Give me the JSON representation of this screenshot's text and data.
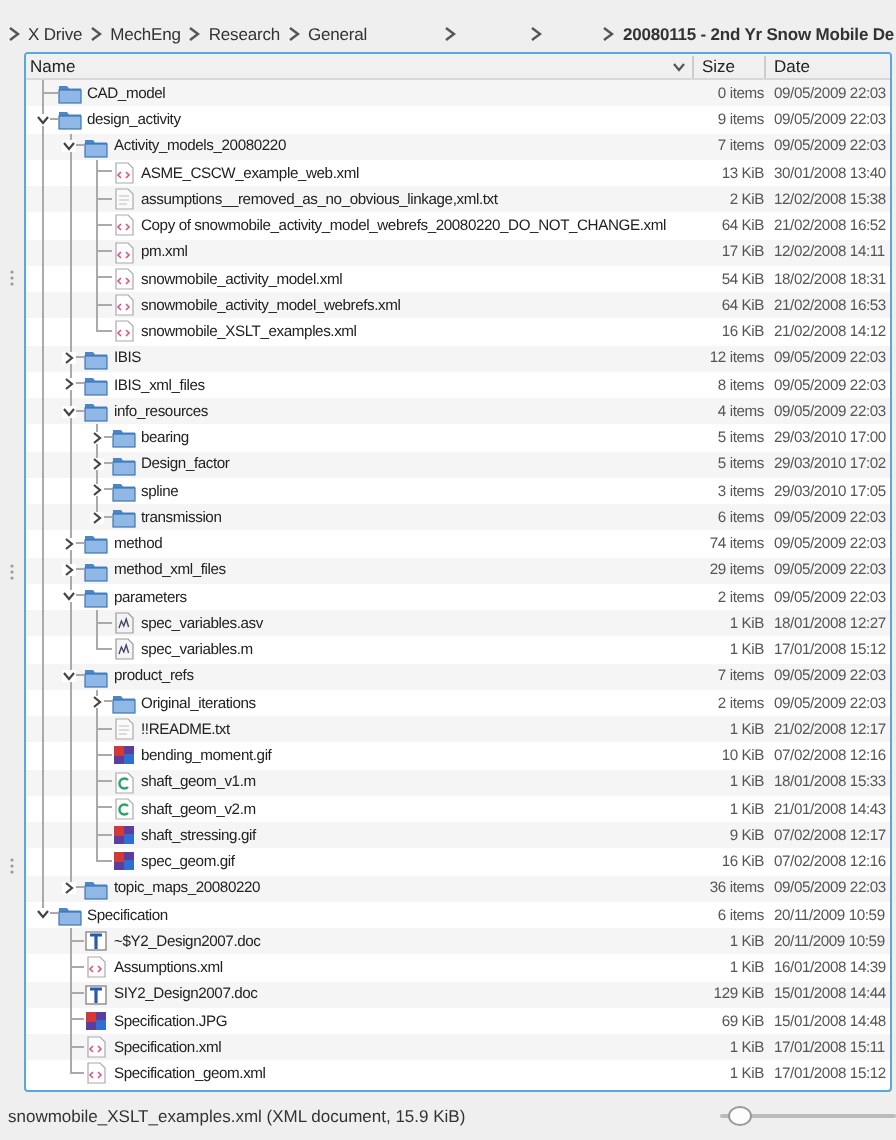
{
  "breadcrumb": [
    {
      "kind": "crumb",
      "label": "X Drive"
    },
    {
      "kind": "crumb",
      "label": "MechEng"
    },
    {
      "kind": "crumb",
      "label": "Research"
    },
    {
      "kind": "crumb",
      "label": "General"
    },
    {
      "kind": "gap"
    },
    {
      "kind": "gap"
    },
    {
      "kind": "current",
      "label": "20080115 - 2nd Yr Snow Mobile De"
    }
  ],
  "columns": [
    {
      "label": "Name",
      "sorted": true
    },
    {
      "label": "Size",
      "sorted": false
    },
    {
      "label": "Date",
      "sorted": false
    }
  ],
  "tree": [
    {
      "kind": "folder",
      "name": "CAD_model",
      "size": "0 items",
      "date": "09/05/2009 22:03"
    },
    {
      "kind": "folder",
      "name": "design_activity",
      "size": "9 items",
      "date": "09/05/2009 22:03",
      "expanded": true,
      "children": [
        {
          "kind": "folder",
          "name": "Activity_models_20080220",
          "size": "7 items",
          "date": "09/05/2009 22:03",
          "expanded": true,
          "children": [
            {
              "kind": "xml",
              "name": "ASME_CSCW_example_web.xml",
              "size": "13 KiB",
              "date": "30/01/2008 13:40"
            },
            {
              "kind": "text",
              "name": "assumptions__removed_as_no_obvious_linkage,xml.txt",
              "size": "2 KiB",
              "date": "12/02/2008 15:38"
            },
            {
              "kind": "xml",
              "name": "Copy of snowmobile_activity_model_webrefs_20080220_DO_NOT_CHANGE.xml",
              "size": "64 KiB",
              "date": "21/02/2008 16:52"
            },
            {
              "kind": "xml",
              "name": "pm.xml",
              "size": "17 KiB",
              "date": "12/02/2008 14:11"
            },
            {
              "kind": "xml",
              "name": "snowmobile_activity_model.xml",
              "size": "54 KiB",
              "date": "18/02/2008 18:31"
            },
            {
              "kind": "xml",
              "name": "snowmobile_activity_model_webrefs.xml",
              "size": "64 KiB",
              "date": "21/02/2008 16:53"
            },
            {
              "kind": "xml",
              "name": "snowmobile_XSLT_examples.xml",
              "size": "16 KiB",
              "date": "21/02/2008 14:12"
            }
          ]
        },
        {
          "kind": "folder",
          "name": "IBIS",
          "size": "12 items",
          "date": "09/05/2009 22:03",
          "expanded": false
        },
        {
          "kind": "folder",
          "name": "IBIS_xml_files",
          "size": "8 items",
          "date": "09/05/2009 22:03",
          "expanded": false
        },
        {
          "kind": "folder",
          "name": "info_resources",
          "size": "4 items",
          "date": "09/05/2009 22:03",
          "expanded": true,
          "children": [
            {
              "kind": "folder",
              "name": "bearing",
              "size": "5 items",
              "date": "29/03/2010 17:00",
              "expanded": false
            },
            {
              "kind": "folder",
              "name": "Design_factor",
              "size": "5 items",
              "date": "29/03/2010 17:02",
              "expanded": false
            },
            {
              "kind": "folder",
              "name": "spline",
              "size": "3 items",
              "date": "29/03/2010 17:05",
              "expanded": false
            },
            {
              "kind": "folder",
              "name": "transmission",
              "size": "6 items",
              "date": "09/05/2009 22:03",
              "expanded": false
            }
          ]
        },
        {
          "kind": "folder",
          "name": "method",
          "size": "74 items",
          "date": "09/05/2009 22:03",
          "expanded": false
        },
        {
          "kind": "folder",
          "name": "method_xml_files",
          "size": "29 items",
          "date": "09/05/2009 22:03",
          "expanded": false
        },
        {
          "kind": "folder",
          "name": "parameters",
          "size": "2 items",
          "date": "09/05/2009 22:03",
          "expanded": true,
          "children": [
            {
              "kind": "matlab",
              "name": "spec_variables.asv",
              "size": "1 KiB",
              "date": "18/01/2008 12:27"
            },
            {
              "kind": "matlab",
              "name": "spec_variables.m",
              "size": "1 KiB",
              "date": "17/01/2008 15:12"
            }
          ]
        },
        {
          "kind": "folder",
          "name": "product_refs",
          "size": "7 items",
          "date": "09/05/2009 22:03",
          "expanded": true,
          "children": [
            {
              "kind": "folder",
              "name": "Original_iterations",
              "size": "2 items",
              "date": "09/05/2009 22:03",
              "expanded": false
            },
            {
              "kind": "text",
              "name": "!!README.txt",
              "size": "1 KiB",
              "date": "21/02/2008 12:17"
            },
            {
              "kind": "image",
              "name": "bending_moment.gif",
              "size": "10 KiB",
              "date": "07/02/2008 12:16"
            },
            {
              "kind": "source",
              "name": "shaft_geom_v1.m",
              "size": "1 KiB",
              "date": "18/01/2008 15:33"
            },
            {
              "kind": "source",
              "name": "shaft_geom_v2.m",
              "size": "1 KiB",
              "date": "21/01/2008 14:43"
            },
            {
              "kind": "image",
              "name": "shaft_stressing.gif",
              "size": "9 KiB",
              "date": "07/02/2008 12:17"
            },
            {
              "kind": "image",
              "name": "spec_geom.gif",
              "size": "16 KiB",
              "date": "07/02/2008 12:16"
            }
          ]
        },
        {
          "kind": "folder",
          "name": "topic_maps_20080220",
          "size": "36 items",
          "date": "09/05/2009 22:03",
          "expanded": false
        }
      ]
    },
    {
      "kind": "folder",
      "name": "Specification",
      "size": "6 items",
      "date": "20/11/2009 10:59",
      "expanded": true,
      "children": [
        {
          "kind": "doc",
          "name": "~$Y2_Design2007.doc",
          "size": "1 KiB",
          "date": "20/11/2009 10:59"
        },
        {
          "kind": "xml",
          "name": "Assumptions.xml",
          "size": "1 KiB",
          "date": "16/01/2008 14:39"
        },
        {
          "kind": "doc",
          "name": "SIY2_Design2007.doc",
          "size": "129 KiB",
          "date": "15/01/2008 14:44"
        },
        {
          "kind": "image",
          "name": "Specification.JPG",
          "size": "69 KiB",
          "date": "15/01/2008 14:48"
        },
        {
          "kind": "xml",
          "name": "Specification.xml",
          "size": "1 KiB",
          "date": "17/01/2008 15:11"
        },
        {
          "kind": "xml",
          "name": "Specification_geom.xml",
          "size": "1 KiB",
          "date": "17/01/2008 15:12"
        }
      ]
    }
  ],
  "status_bar": {
    "text": "snowmobile_XSLT_examples.xml (XML document, 15.9 KiB)",
    "zoom_slider": {
      "level": 0.05
    }
  }
}
